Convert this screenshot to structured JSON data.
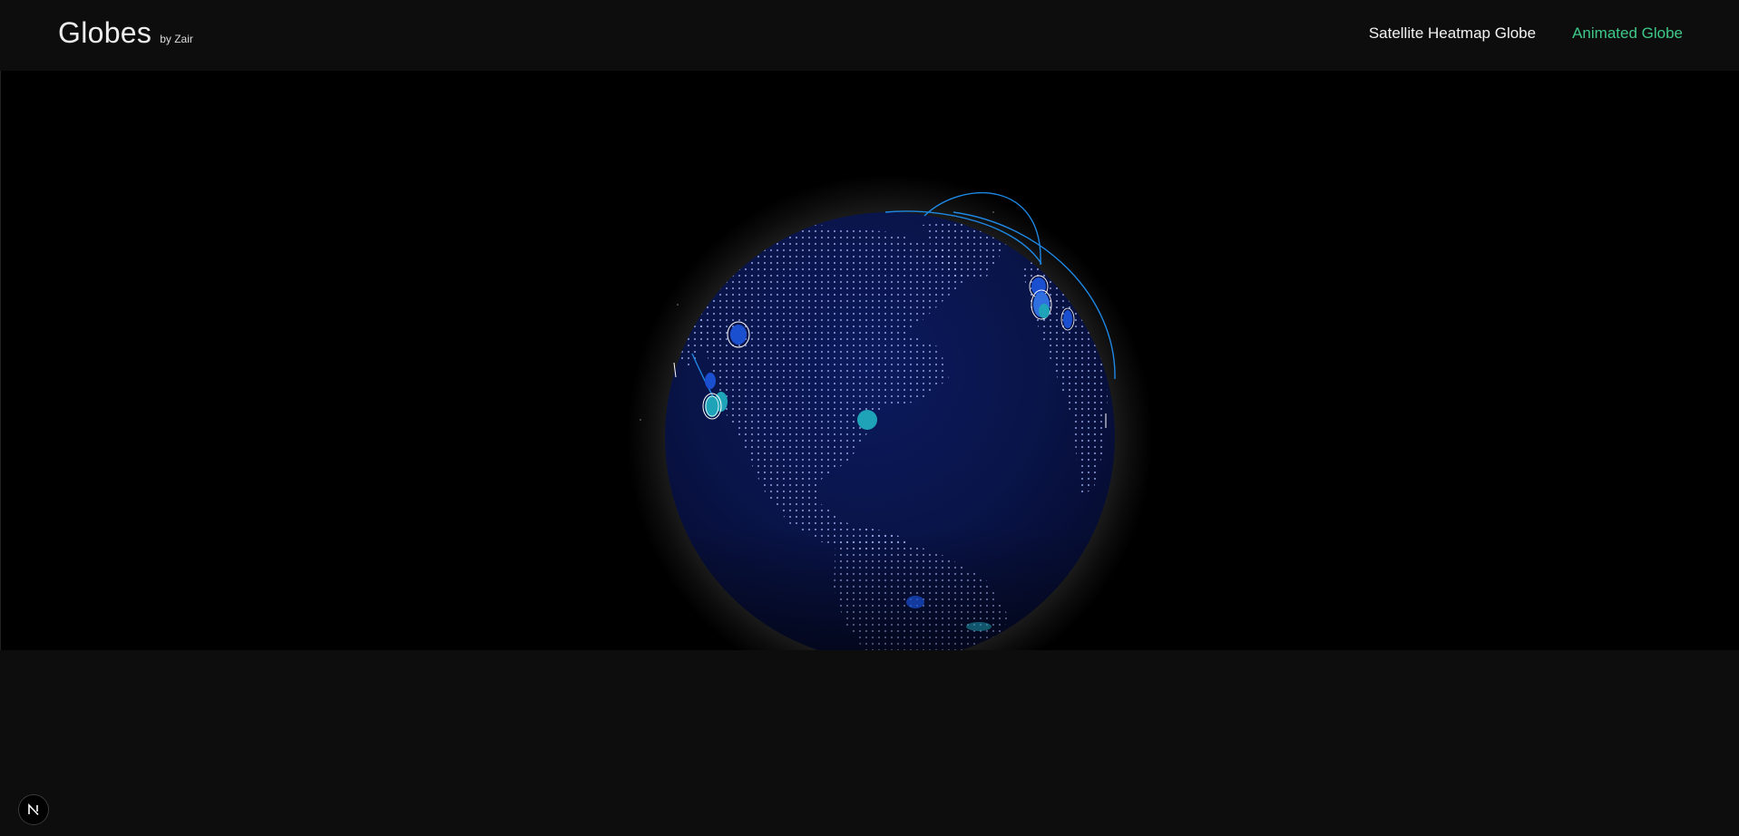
{
  "header": {
    "title": "Globes",
    "subtitle": "by Zair"
  },
  "nav": {
    "items": [
      {
        "label": "Satellite Heatmap Globe",
        "active": false
      },
      {
        "label": "Animated Globe",
        "active": true
      }
    ],
    "active_color": "#3ec98a"
  },
  "globe": {
    "ocean_color": "#0b1552",
    "land_dot_color": "#8fa0e0",
    "arc_color": "#1e88e5",
    "ring_color": "#ffffff",
    "marker_colors": [
      "#1a4fd0",
      "#1fa3b8",
      "#2f6fe0"
    ]
  },
  "badge": {
    "icon": "nextjs-icon",
    "letter": "N"
  }
}
